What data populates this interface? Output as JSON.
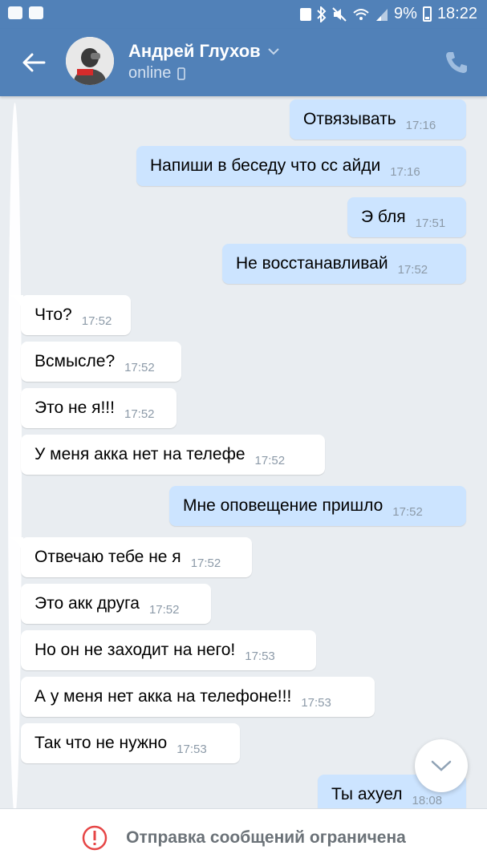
{
  "status_bar": {
    "battery": "9%",
    "time": "18:22"
  },
  "header": {
    "contact_name": "Андрей Глухов",
    "status": "online",
    "icons": [
      "back-arrow-icon",
      "chevron-down-icon",
      "mobile-device-icon",
      "phone-icon"
    ]
  },
  "messages": [
    {
      "dir": "out",
      "text": "Отвязывать",
      "time": "17:16"
    },
    {
      "dir": "out",
      "text": "Напиши в беседу что сс айди",
      "time": "17:16"
    },
    {
      "dir": "out",
      "text": "Э бля",
      "time": "17:51"
    },
    {
      "dir": "out",
      "text": "Не восстанавливай",
      "time": "17:52"
    },
    {
      "dir": "in",
      "text": "Что?",
      "time": "17:52"
    },
    {
      "dir": "in",
      "text": "Всмысле?",
      "time": "17:52"
    },
    {
      "dir": "in",
      "text": "Это не я!!!",
      "time": "17:52"
    },
    {
      "dir": "in",
      "text": "У меня акка нет на телефе",
      "time": "17:52"
    },
    {
      "dir": "out",
      "text": "Мне оповещение пришло",
      "time": "17:52"
    },
    {
      "dir": "in",
      "text": "Отвечаю тебе не я",
      "time": "17:52"
    },
    {
      "dir": "in",
      "text": "Это акк друга",
      "time": "17:52"
    },
    {
      "dir": "in",
      "text": "Но он не заходит на него!",
      "time": "17:53"
    },
    {
      "dir": "in",
      "text": "А у меня нет акка на телефоне!!!",
      "time": "17:53"
    },
    {
      "dir": "in",
      "text": "Так что не нужно",
      "time": "17:53"
    },
    {
      "dir": "out",
      "text": "Ты ахуел",
      "time": "18:08"
    }
  ],
  "bottom": {
    "restricted_text": "Отправка сообщений ограничена",
    "icon": "alert-circle-icon"
  },
  "colors": {
    "header": "#5181b8",
    "outgoing_bubble": "#cce4ff",
    "incoming_bubble": "#ffffff",
    "background": "#e9edf1",
    "alert": "#e64646"
  }
}
